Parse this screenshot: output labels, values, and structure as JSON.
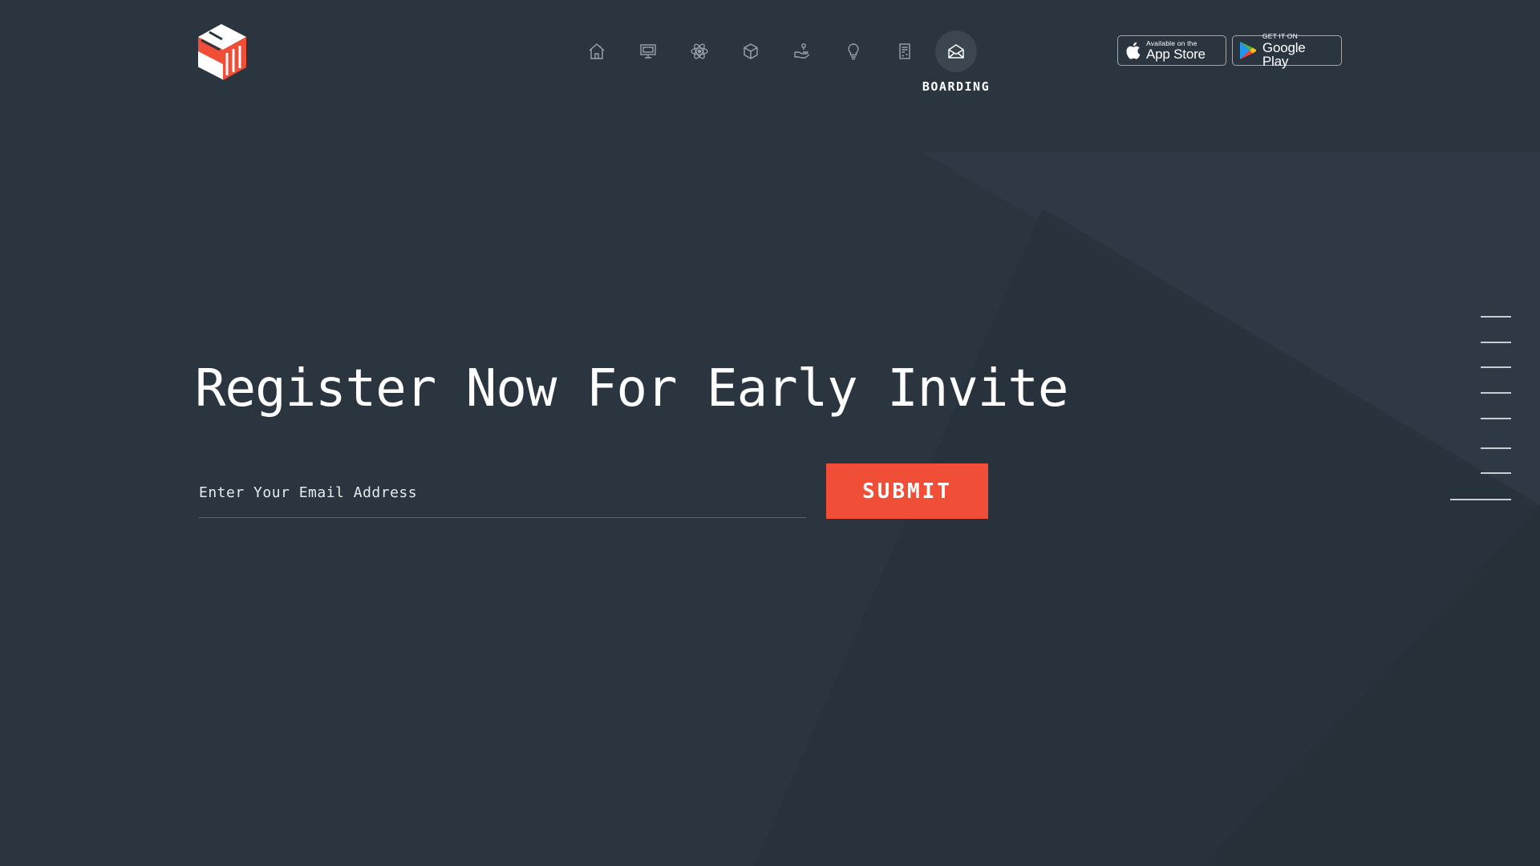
{
  "logo": {
    "icon": "cube-logo-icon",
    "colors": {
      "white": "#ffffff",
      "red": "#f04e37"
    }
  },
  "nav": {
    "items": [
      {
        "name": "home",
        "icon": "home-icon"
      },
      {
        "name": "presentation",
        "icon": "presentation-board-icon"
      },
      {
        "name": "atom",
        "icon": "atom-icon"
      },
      {
        "name": "cube",
        "icon": "cube-icon"
      },
      {
        "name": "hand",
        "icon": "hand-coin-icon"
      },
      {
        "name": "idea",
        "icon": "lightbulb-icon"
      },
      {
        "name": "document",
        "icon": "document-icon"
      },
      {
        "name": "boarding",
        "icon": "envelope-icon",
        "label": "BOARDING",
        "active": true
      }
    ]
  },
  "store": {
    "apple": {
      "small": "Available on the",
      "big": "App Store",
      "icon": "apple-icon"
    },
    "google": {
      "small": "GET IT ON",
      "big": "Google Play",
      "icon": "google-play-icon"
    }
  },
  "main": {
    "headline": "Register Now For Early Invite",
    "email_placeholder": "Enter Your Email Address",
    "submit_label": "SUBMIT"
  },
  "side_nav": {
    "count": 8,
    "active_index": 7
  },
  "colors": {
    "background": "#2b3540",
    "accent": "#f04e37",
    "text": "#ffffff",
    "icon": "#9aa3ad"
  }
}
